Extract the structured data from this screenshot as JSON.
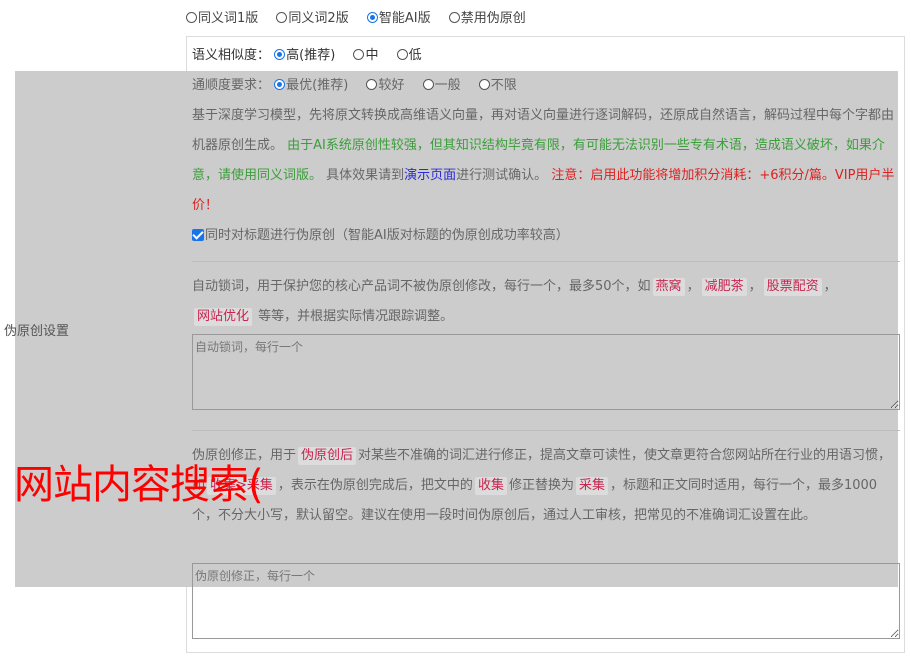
{
  "top_options": [
    {
      "label": "同义词1版",
      "checked": false
    },
    {
      "label": "同义词2版",
      "checked": false
    },
    {
      "label": "智能AI版",
      "checked": true
    },
    {
      "label": "禁用伪原创",
      "checked": false
    }
  ],
  "similarity": {
    "label": "语义相似度：",
    "options": [
      {
        "label": "高(推荐)",
        "checked": true
      },
      {
        "label": "中",
        "checked": false
      },
      {
        "label": "低",
        "checked": false
      }
    ]
  },
  "fluency": {
    "label": "通顺度要求：",
    "options": [
      {
        "label": "最优(推荐)",
        "checked": true
      },
      {
        "label": "较好",
        "checked": false
      },
      {
        "label": "一般",
        "checked": false
      },
      {
        "label": "不限",
        "checked": false
      }
    ]
  },
  "description": {
    "plain1": "基于深度学习模型，先将原文转换成高维语义向量，再对语义向量进行逐词解码，还原成自然语言，解码过程中每个字都由机器原创生成。",
    "green": " 由于AI系统原创性较强，但其知识结构毕竟有限，有可能无法识别一些专有术语，造成语义破坏，如果介意，请使用同义词版。",
    "plain2": " 具体效果请到",
    "link": "演示页面",
    "plain3": "进行测试确认。",
    "red": " 注意：启用此功能将增加积分消耗：+6积分/篇。VIP用户半价！"
  },
  "title_checkbox": {
    "label": "同时对标题进行伪原创（智能AI版对标题的伪原创成功率较高）",
    "checked": true
  },
  "lock_words": {
    "text1": "自动锁词，用于保护您的核心产品词不被伪原创修改，每行一个，最多50个，如",
    "examples": [
      "燕窝",
      "减肥茶",
      "股票配资",
      "网站优化"
    ],
    "sep": "，",
    "text2": "等等，并根据实际情况跟踪调整。",
    "placeholder": "自动锁词，每行一个"
  },
  "correction": {
    "text1": "伪原创修正，用于",
    "tag1": "伪原创后",
    "text2": "对某些不准确的词汇进行修正，提高文章可读性，使文章更符合您网站所在行业的用语习惯，如",
    "tag2": "收集>采集",
    "text3": "，表示在伪原创完成后，把文中的",
    "tag3": "收集",
    "text4": "修正替换为",
    "tag4": "采集",
    "text5": "，标题和正文同时适用，每行一个，最多1000个，不分大小写，默认留空。建议在使用一段时间伪原创后，通过人工审核，把常见的不准确词汇设置在此。",
    "placeholder": "伪原创修正，每行一个"
  },
  "side_label": "伪原创设置",
  "overlay_caption": "网站内容搜索(",
  "colors": {
    "accent": "#1a73e8",
    "overlay_gray": "#cccccc",
    "green": "#3a9e3a",
    "red": "#dd2222",
    "caption_red": "#ff0000"
  }
}
